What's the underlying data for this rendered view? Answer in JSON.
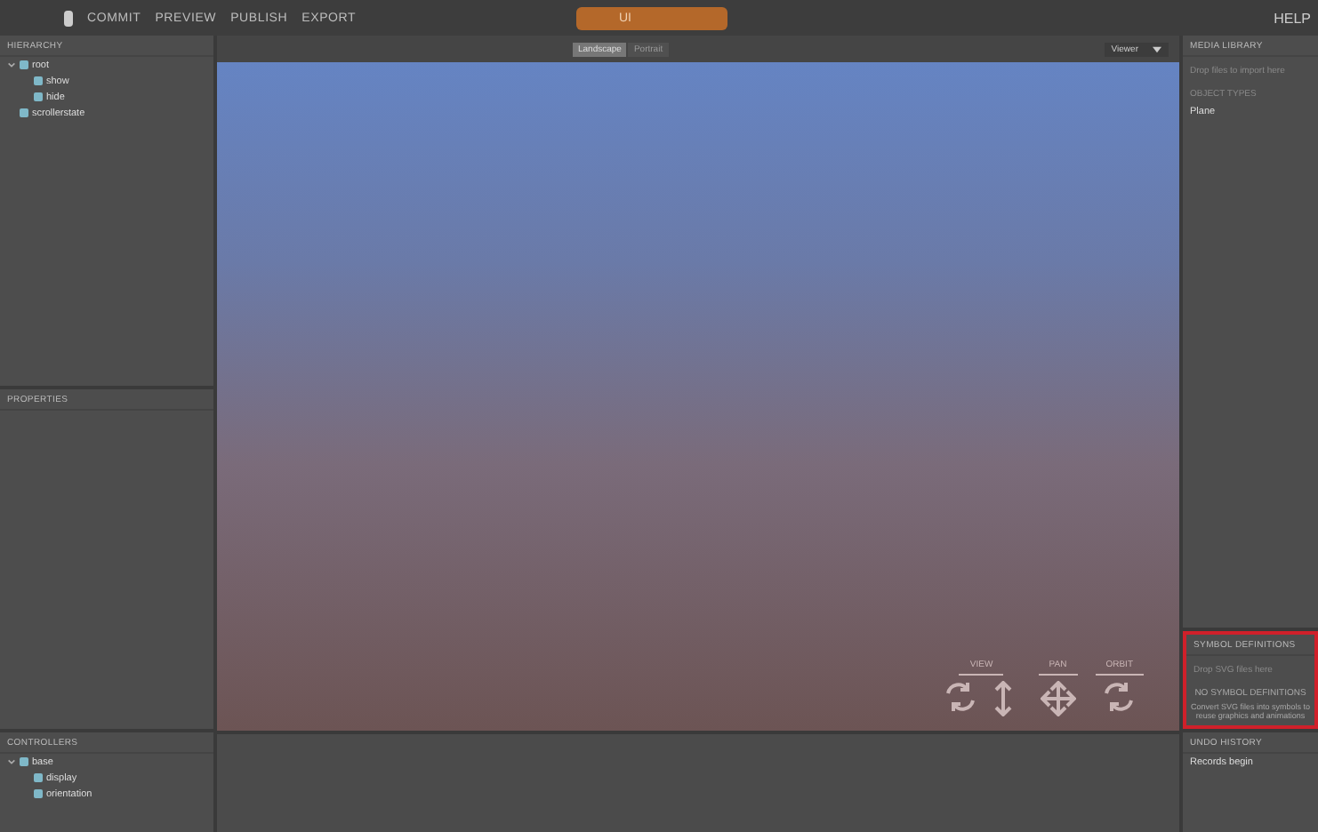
{
  "top_bar": {
    "menu": [
      {
        "label": "COMMIT"
      },
      {
        "label": "PREVIEW"
      },
      {
        "label": "PUBLISH"
      },
      {
        "label": "EXPORT"
      }
    ],
    "document_title": "UI",
    "help": "HELP"
  },
  "hierarchy": {
    "title": "HIERARCHY",
    "items": [
      {
        "label": "root",
        "expanded": true,
        "children": [
          {
            "label": "show"
          },
          {
            "label": "hide"
          }
        ]
      },
      {
        "label": "scrollerstate"
      }
    ]
  },
  "properties": {
    "title": "PROPERTIES"
  },
  "controllers": {
    "title": "CONTROLLERS",
    "items": [
      {
        "label": "base",
        "expanded": true,
        "children": [
          {
            "label": "display"
          },
          {
            "label": "orientation"
          }
        ]
      }
    ]
  },
  "toolbar": {
    "orientations": [
      {
        "label": "Landscape",
        "selected": true
      },
      {
        "label": "Portrait",
        "selected": false
      }
    ],
    "viewer_select": "Viewer"
  },
  "viewport": {
    "controls": [
      {
        "label": "VIEW"
      },
      {
        "label": "PAN"
      },
      {
        "label": "ORBIT"
      }
    ]
  },
  "media_library": {
    "title": "MEDIA LIBRARY",
    "drop_hint": "Drop files to import here",
    "object_types": "OBJECT TYPES",
    "items": [
      "Plane"
    ]
  },
  "symbol_definitions": {
    "title": "SYMBOL DEFINITIONS",
    "drop_hint": "Drop SVG files here",
    "empty": "NO SYMBOL DEFINITIONS",
    "note": "Convert SVG files into symbols to reuse graphics and animations"
  },
  "undo_history": {
    "title": "UNDO HISTORY",
    "items": [
      "Records begin"
    ]
  }
}
